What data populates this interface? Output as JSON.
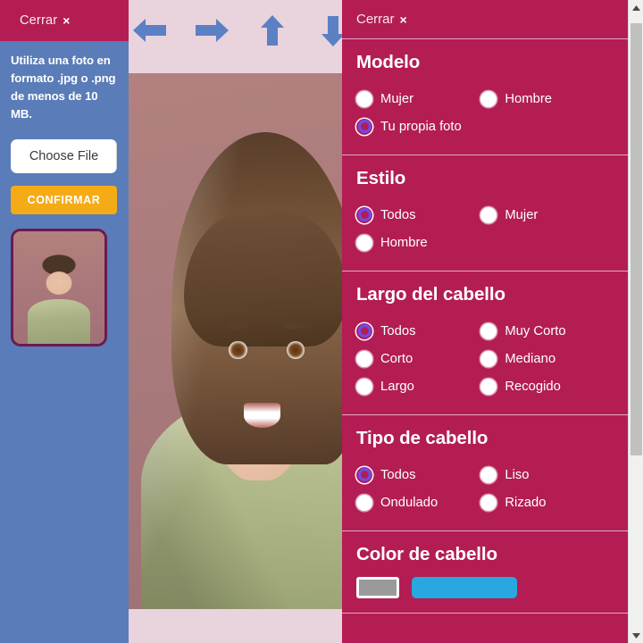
{
  "upload_panel": {
    "header": {
      "close_label": "Cerrar",
      "close_glyph": "×"
    },
    "hint": "Utiliza una foto en formato .jpg o .png de menos de 10 MB.",
    "file_input_label": "Choose File",
    "confirm_label": "CONFIRMAR",
    "thumbnail_alt": "Foto de usuaria cargada",
    "background_color": "#5a7cb8",
    "header_color": "#b31d54",
    "confirm_color": "#f5ab16"
  },
  "preview": {
    "nav_arrows": [
      {
        "name": "arrow-left-icon",
        "direction": "left"
      },
      {
        "name": "arrow-right-icon",
        "direction": "right"
      },
      {
        "name": "arrow-up-icon",
        "direction": "up"
      },
      {
        "name": "arrow-down-icon",
        "direction": "down"
      }
    ],
    "arrow_color": "#5b80c4",
    "stage_background": "#e9d3dd",
    "photo_alt": "Modelo con peinado bob y flequillo"
  },
  "options_panel": {
    "header": {
      "close_label": "Cerrar",
      "close_glyph": "×"
    },
    "background_color": "#b31d54",
    "accent_color": "#6d4bf0",
    "sections": [
      {
        "title": "Modelo",
        "name": "modelo",
        "options": [
          {
            "label": "Mujer",
            "checked": false,
            "width": "half"
          },
          {
            "label": "Hombre",
            "checked": false,
            "width": "half"
          },
          {
            "label": "Tu propia foto",
            "checked": true,
            "width": "full"
          }
        ]
      },
      {
        "title": "Estilo",
        "name": "estilo",
        "options": [
          {
            "label": "Todos",
            "checked": true,
            "width": "half"
          },
          {
            "label": "Mujer",
            "checked": false,
            "width": "half"
          },
          {
            "label": "Hombre",
            "checked": false,
            "width": "full"
          }
        ]
      },
      {
        "title": "Largo del cabello",
        "name": "largo-del-cabello",
        "options": [
          {
            "label": "Todos",
            "checked": true,
            "width": "half"
          },
          {
            "label": "Muy Corto",
            "checked": false,
            "width": "half"
          },
          {
            "label": "Corto",
            "checked": false,
            "width": "half"
          },
          {
            "label": "Mediano",
            "checked": false,
            "width": "half"
          },
          {
            "label": "Largo",
            "checked": false,
            "width": "half"
          },
          {
            "label": "Recogido",
            "checked": false,
            "width": "half"
          }
        ]
      },
      {
        "title": "Tipo de cabello",
        "name": "tipo-de-cabello",
        "options": [
          {
            "label": "Todos",
            "checked": true,
            "width": "half"
          },
          {
            "label": "Liso",
            "checked": false,
            "width": "half"
          },
          {
            "label": "Ondulado",
            "checked": false,
            "width": "half"
          },
          {
            "label": "Rizado",
            "checked": false,
            "width": "half"
          }
        ]
      },
      {
        "title": "Color de cabello",
        "name": "color-de-cabello",
        "options": [],
        "color_controls": {
          "swatch_color": "#9a9a9a",
          "pill_color": "#27a8e0"
        }
      }
    ]
  },
  "scrollbar": {
    "up_arrow": "scroll-up-icon",
    "down_arrow": "scroll-down-icon",
    "thumb_color": "#c0c0c0",
    "track_color": "#f0f0f0"
  }
}
